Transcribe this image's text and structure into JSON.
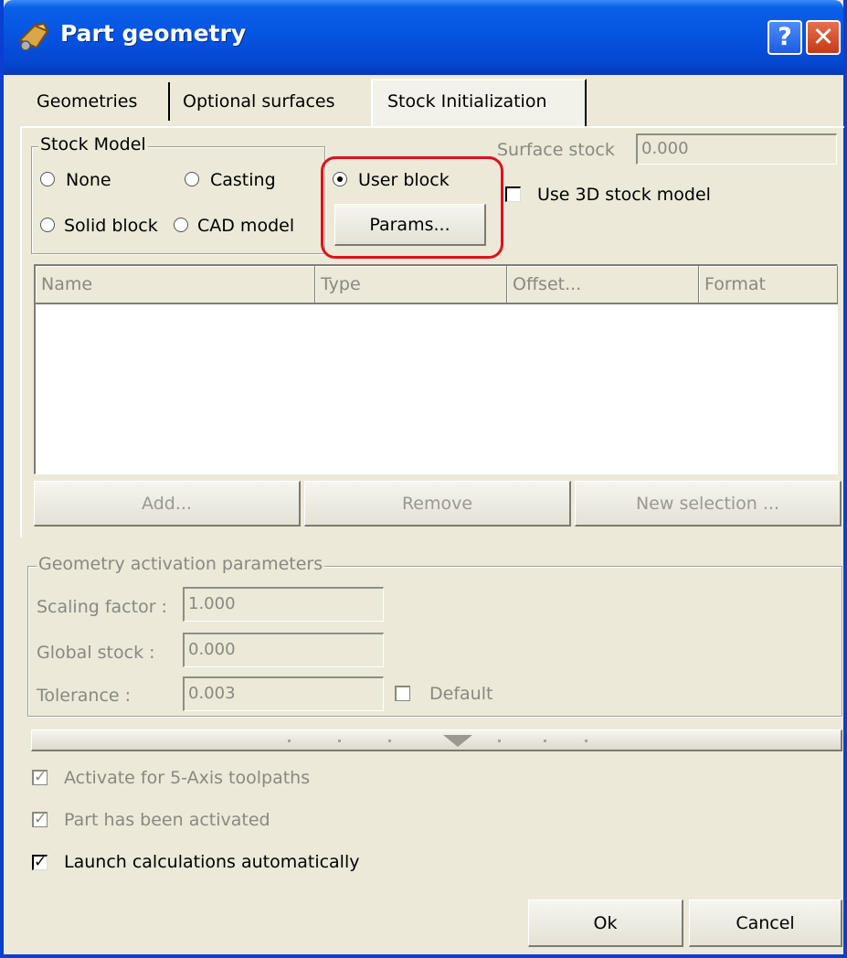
{
  "window": {
    "title": "Part geometry",
    "help_label": "?",
    "close_label": "✕"
  },
  "tabs": [
    {
      "label": "Geometries"
    },
    {
      "label": "Optional surfaces"
    },
    {
      "label": "Stock Initialization",
      "active": true
    }
  ],
  "stock_model": {
    "title": "Stock Model",
    "options": [
      {
        "label": "None",
        "selected": false
      },
      {
        "label": "Casting",
        "selected": false
      },
      {
        "label": "User block",
        "selected": true
      },
      {
        "label": "Solid block",
        "selected": false
      },
      {
        "label": "CAD model",
        "selected": false
      }
    ],
    "params_button": "Params..."
  },
  "surface_stock": {
    "label": "Surface stock",
    "value": "0.000"
  },
  "use_3d_stock": {
    "label": "Use 3D stock model",
    "checked": false
  },
  "table": {
    "columns": [
      "Name",
      "Type",
      "Offset...",
      "Format"
    ],
    "rows": []
  },
  "table_buttons": {
    "add": "Add...",
    "remove": "Remove",
    "new_selection": "New selection ..."
  },
  "activation": {
    "title": "Geometry activation parameters",
    "scaling_label": "Scaling factor :",
    "scaling_value": "1.000",
    "global_stock_label": "Global stock :",
    "global_stock_value": "0.000",
    "tolerance_label": "Tolerance :",
    "tolerance_value": "0.003",
    "default_label": "Default",
    "default_checked": false
  },
  "options": {
    "activate_5axis": {
      "label": "Activate for 5-Axis toolpaths",
      "checked": true,
      "disabled": true
    },
    "part_activated": {
      "label": "Part has been activated",
      "checked": true,
      "disabled": true
    },
    "launch_auto": {
      "label": "Launch calculations automatically",
      "checked": true,
      "disabled": false
    }
  },
  "footer": {
    "ok": "Ok",
    "cancel": "Cancel"
  },
  "colors": {
    "titlebar": "#0553e0",
    "highlight": "#e0101a",
    "dialog_bg": "#ece9d8"
  }
}
